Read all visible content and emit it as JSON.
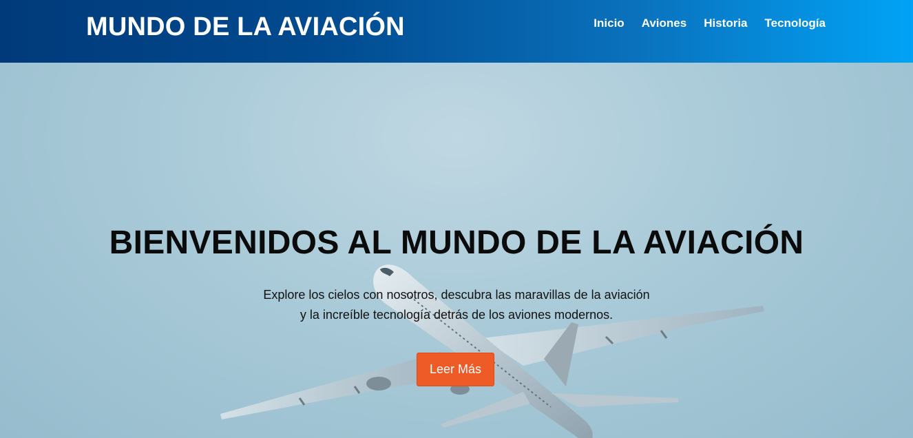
{
  "header": {
    "brand": "MUNDO DE LA AVIACIÓN",
    "nav": [
      "Inicio",
      "Aviones",
      "Historia",
      "Tecnología"
    ]
  },
  "hero": {
    "title": "BIENVENIDOS AL MUNDO DE LA AVIACIÓN",
    "text_line1": "Explore los cielos con nosotros, descubra las maravillas de la aviación",
    "text_line2": "y la increíble tecnología detrás de los aviones modernos.",
    "button_label": "Leer Más"
  },
  "colors": {
    "header_start": "#013a7a",
    "header_end": "#01a3f6",
    "button": "#ee5b26",
    "sky": "#a9cad8"
  }
}
